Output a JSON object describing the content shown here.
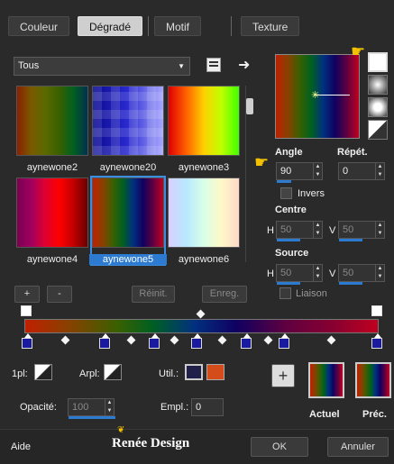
{
  "tabs": [
    {
      "label": "Couleur"
    },
    {
      "label": "Dégradé"
    },
    {
      "label": "Motif"
    },
    {
      "label": "Texture"
    }
  ],
  "category_dropdown": {
    "value": "Tous"
  },
  "thumbnails": [
    {
      "label": "aynewone2"
    },
    {
      "label": "aynewone20"
    },
    {
      "label": "aynewone3"
    },
    {
      "label": "aynewone4"
    },
    {
      "label": "aynewone5"
    },
    {
      "label": "aynewone6"
    }
  ],
  "buttons": {
    "add": "+",
    "remove": "-",
    "reset": "Réinit.",
    "save": "Enreg.",
    "plus": "+",
    "ok": "OK",
    "cancel": "Annuler",
    "help": "Aide"
  },
  "angle": {
    "label": "Angle",
    "value": "90"
  },
  "repeat": {
    "label": "Répét.",
    "value": "0"
  },
  "invert": {
    "label": "Invers",
    "checked": false
  },
  "center": {
    "label": "Centre",
    "h_label": "H",
    "h_value": "50",
    "v_label": "V",
    "v_value": "50"
  },
  "source": {
    "label": "Source",
    "h_label": "H",
    "h_value": "50",
    "v_label": "V",
    "v_value": "50"
  },
  "link": {
    "label": "Liaison"
  },
  "bottom": {
    "pl_label": "1pl:",
    "arpl_label": "Arpl:",
    "util_label": "Util.:",
    "opacity_label": "Opacité:",
    "opacity_value": "100",
    "empl_label": "Empl.:",
    "empl_value": "0",
    "current_label": "Actuel",
    "previous_label": "Préc."
  },
  "footer": {
    "brand": "Renée Design"
  },
  "colors": {
    "accent": "#2d7bd0",
    "util_dark": "#20204a",
    "util_orange": "#d44c1a"
  },
  "icons": [
    "gradient-editor-icon",
    "arrow-right-icon",
    "pointer-hand-icon",
    "linear-style-icon",
    "radial-style-icon",
    "rectangular-style-icon",
    "sunburst-style-icon"
  ]
}
